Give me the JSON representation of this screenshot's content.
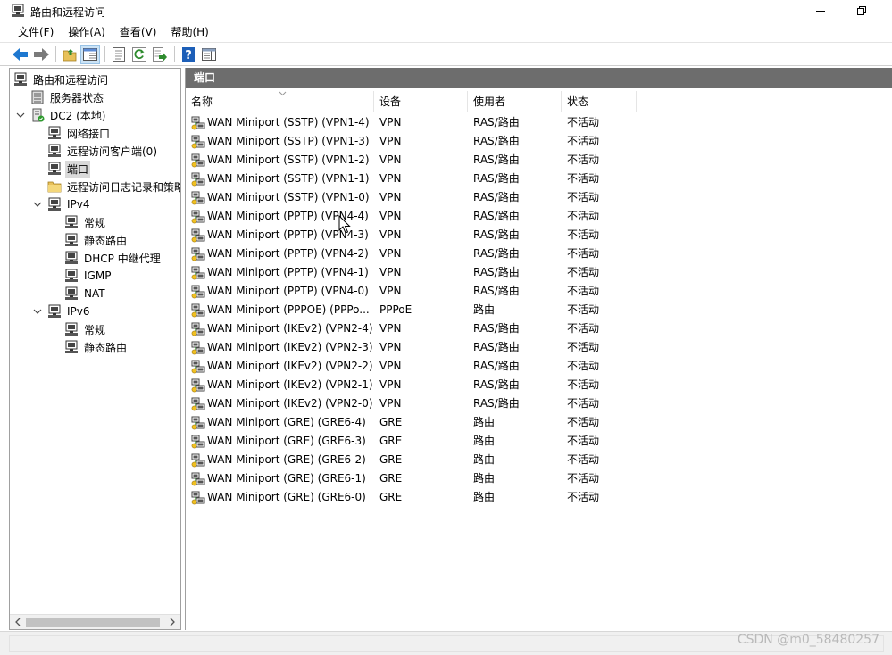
{
  "window": {
    "title": "路由和远程访问"
  },
  "menu": [
    "文件(F)",
    "操作(A)",
    "查看(V)",
    "帮助(H)"
  ],
  "tree": {
    "root": "路由和远程访问",
    "server_status": "服务器状态",
    "server": "DC2 (本地)",
    "network_interfaces": "网络接口",
    "remote_clients": "远程访问客户端(0)",
    "ports": "端口",
    "logging": "远程访问日志记录和策略",
    "ipv4": "IPv4",
    "ipv4_general": "常规",
    "ipv4_static_routes": "静态路由",
    "dhcp_relay": "DHCP 中继代理",
    "igmp": "IGMP",
    "nat": "NAT",
    "ipv6": "IPv6",
    "ipv6_general": "常规",
    "ipv6_static_routes": "静态路由"
  },
  "pane": {
    "header": "端口"
  },
  "columns": {
    "name": "名称",
    "device": "设备",
    "user": "使用者",
    "state": "状态"
  },
  "rows": [
    {
      "name": "WAN Miniport (SSTP) (VPN1-4)",
      "device": "VPN",
      "user": "RAS/路由",
      "state": "不活动"
    },
    {
      "name": "WAN Miniport (SSTP) (VPN1-3)",
      "device": "VPN",
      "user": "RAS/路由",
      "state": "不活动"
    },
    {
      "name": "WAN Miniport (SSTP) (VPN1-2)",
      "device": "VPN",
      "user": "RAS/路由",
      "state": "不活动"
    },
    {
      "name": "WAN Miniport (SSTP) (VPN1-1)",
      "device": "VPN",
      "user": "RAS/路由",
      "state": "不活动"
    },
    {
      "name": "WAN Miniport (SSTP) (VPN1-0)",
      "device": "VPN",
      "user": "RAS/路由",
      "state": "不活动"
    },
    {
      "name": "WAN Miniport (PPTP) (VPN4-4)",
      "device": "VPN",
      "user": "RAS/路由",
      "state": "不活动"
    },
    {
      "name": "WAN Miniport (PPTP) (VPN4-3)",
      "device": "VPN",
      "user": "RAS/路由",
      "state": "不活动"
    },
    {
      "name": "WAN Miniport (PPTP) (VPN4-2)",
      "device": "VPN",
      "user": "RAS/路由",
      "state": "不活动"
    },
    {
      "name": "WAN Miniport (PPTP) (VPN4-1)",
      "device": "VPN",
      "user": "RAS/路由",
      "state": "不活动"
    },
    {
      "name": "WAN Miniport (PPTP) (VPN4-0)",
      "device": "VPN",
      "user": "RAS/路由",
      "state": "不活动"
    },
    {
      "name": "WAN Miniport (PPPOE) (PPPo...",
      "device": "PPPoE",
      "user": "路由",
      "state": "不活动"
    },
    {
      "name": "WAN Miniport (IKEv2) (VPN2-4)",
      "device": "VPN",
      "user": "RAS/路由",
      "state": "不活动"
    },
    {
      "name": "WAN Miniport (IKEv2) (VPN2-3)",
      "device": "VPN",
      "user": "RAS/路由",
      "state": "不活动"
    },
    {
      "name": "WAN Miniport (IKEv2) (VPN2-2)",
      "device": "VPN",
      "user": "RAS/路由",
      "state": "不活动"
    },
    {
      "name": "WAN Miniport (IKEv2) (VPN2-1)",
      "device": "VPN",
      "user": "RAS/路由",
      "state": "不活动"
    },
    {
      "name": "WAN Miniport (IKEv2) (VPN2-0)",
      "device": "VPN",
      "user": "RAS/路由",
      "state": "不活动"
    },
    {
      "name": "WAN Miniport (GRE) (GRE6-4)",
      "device": "GRE",
      "user": "路由",
      "state": "不活动"
    },
    {
      "name": "WAN Miniport (GRE) (GRE6-3)",
      "device": "GRE",
      "user": "路由",
      "state": "不活动"
    },
    {
      "name": "WAN Miniport (GRE) (GRE6-2)",
      "device": "GRE",
      "user": "路由",
      "state": "不活动"
    },
    {
      "name": "WAN Miniport (GRE) (GRE6-1)",
      "device": "GRE",
      "user": "路由",
      "state": "不活动"
    },
    {
      "name": "WAN Miniport (GRE) (GRE6-0)",
      "device": "GRE",
      "user": "路由",
      "state": "不活动"
    }
  ],
  "watermark": "CSDN @m0_58480257",
  "colors": {
    "pane_header_bg": "#6d6d6d",
    "selection_bg": "#d9d9d9",
    "back_arrow": "#1e78d0"
  }
}
